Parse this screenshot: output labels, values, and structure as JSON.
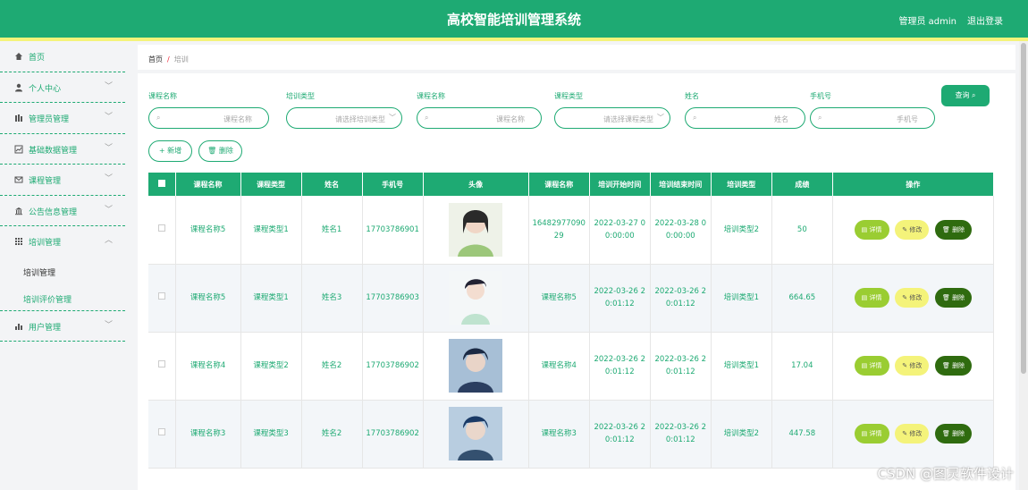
{
  "header": {
    "title": "高校智能培训管理系统",
    "user": "管理员 admin",
    "logout": "退出登录"
  },
  "sidebar": {
    "items": [
      {
        "label": "首页",
        "icon": "home-icon"
      },
      {
        "label": "个人中心",
        "icon": "user-icon"
      },
      {
        "label": "管理员管理",
        "icon": "bars-icon"
      },
      {
        "label": "基础数据管理",
        "icon": "chart-icon"
      },
      {
        "label": "课程管理",
        "icon": "mail-icon"
      },
      {
        "label": "公告信息管理",
        "icon": "bank-icon"
      },
      {
        "label": "培训管理",
        "icon": "grid-icon"
      },
      {
        "label": "用户管理",
        "icon": "bar-chart-icon"
      }
    ],
    "subitems": [
      "培训管理",
      "培训评价管理"
    ]
  },
  "breadcrumb": {
    "home": "首页",
    "sep": "/",
    "current": "培训"
  },
  "search": {
    "fields": [
      {
        "label": "课程名称",
        "placeholder": "课程名称"
      },
      {
        "label": "培训类型",
        "placeholder": "请选择培训类型"
      },
      {
        "label": "课程名称",
        "placeholder": "课程名称"
      },
      {
        "label": "课程类型",
        "placeholder": "请选择课程类型"
      },
      {
        "label": "姓名",
        "placeholder": "姓名"
      },
      {
        "label": "手机号",
        "placeholder": "手机号"
      }
    ],
    "query": "查询"
  },
  "actions": {
    "add": "新增",
    "delete": "删除"
  },
  "table": {
    "headers": [
      "课程名称",
      "课程类型",
      "姓名",
      "手机号",
      "头像",
      "课程名称",
      "培训开始时间",
      "培训结束时间",
      "培训类型",
      "成绩",
      "操作"
    ],
    "rows": [
      [
        "课程名称5",
        "课程类型1",
        "姓名1",
        "17703786901",
        "1648297709029",
        "2022-03-27 00:00:00",
        "2022-03-28 00:00:00",
        "培训类型2",
        "50"
      ],
      [
        "课程名称5",
        "课程类型1",
        "姓名3",
        "17703786903",
        "课程名称5",
        "2022-03-26 20:01:12",
        "2022-03-26 20:01:12",
        "培训类型1",
        "664.65"
      ],
      [
        "课程名称4",
        "课程类型2",
        "姓名2",
        "17703786902",
        "课程名称4",
        "2022-03-26 20:01:12",
        "2022-03-26 20:01:12",
        "培训类型1",
        "17.04"
      ],
      [
        "课程名称3",
        "课程类型3",
        "姓名2",
        "17703786902",
        "课程名称3",
        "2022-03-26 20:01:12",
        "2022-03-26 20:01:12",
        "培训类型2",
        "447.58"
      ]
    ],
    "op_labels": {
      "detail": "详情",
      "edit": "修改",
      "delete": "删除"
    }
  },
  "watermark": "CSDN @图灵软件设计"
}
